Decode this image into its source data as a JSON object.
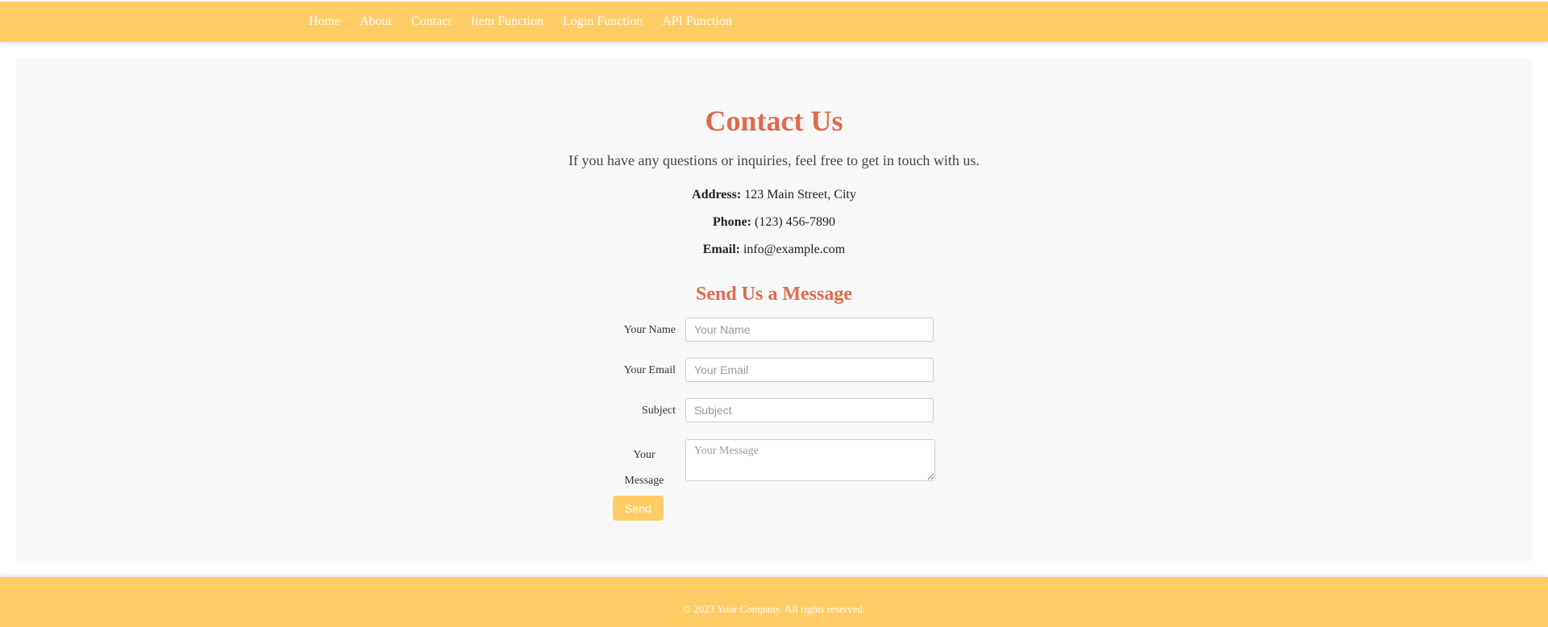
{
  "nav": {
    "items": [
      "Home",
      "About",
      "Contact",
      "Item Function",
      "Login Function",
      "API Function"
    ]
  },
  "contact": {
    "title": "Contact Us",
    "intro": "If you have any questions or inquiries, feel free to get in touch with us.",
    "address_label": "Address:",
    "address_value": "123 Main Street, City",
    "phone_label": "Phone:",
    "phone_value": "(123) 456-7890",
    "email_label": "Email:",
    "email_value": "info@example.com"
  },
  "form": {
    "title": "Send Us a Message",
    "name_label": "Your Name",
    "name_placeholder": "Your Name",
    "email_label": "Your Email",
    "email_placeholder": "Your Email",
    "subject_label": "Subject",
    "subject_placeholder": "Subject",
    "message_label": "Your Message",
    "message_placeholder": "Your Message",
    "send_label": "Send"
  },
  "footer": {
    "text": "© 2023 Your Company. All rights reserved."
  },
  "colors": {
    "accent": "#ffcc66",
    "heading": "#e06a4c",
    "panel": "#f8f8f8"
  }
}
